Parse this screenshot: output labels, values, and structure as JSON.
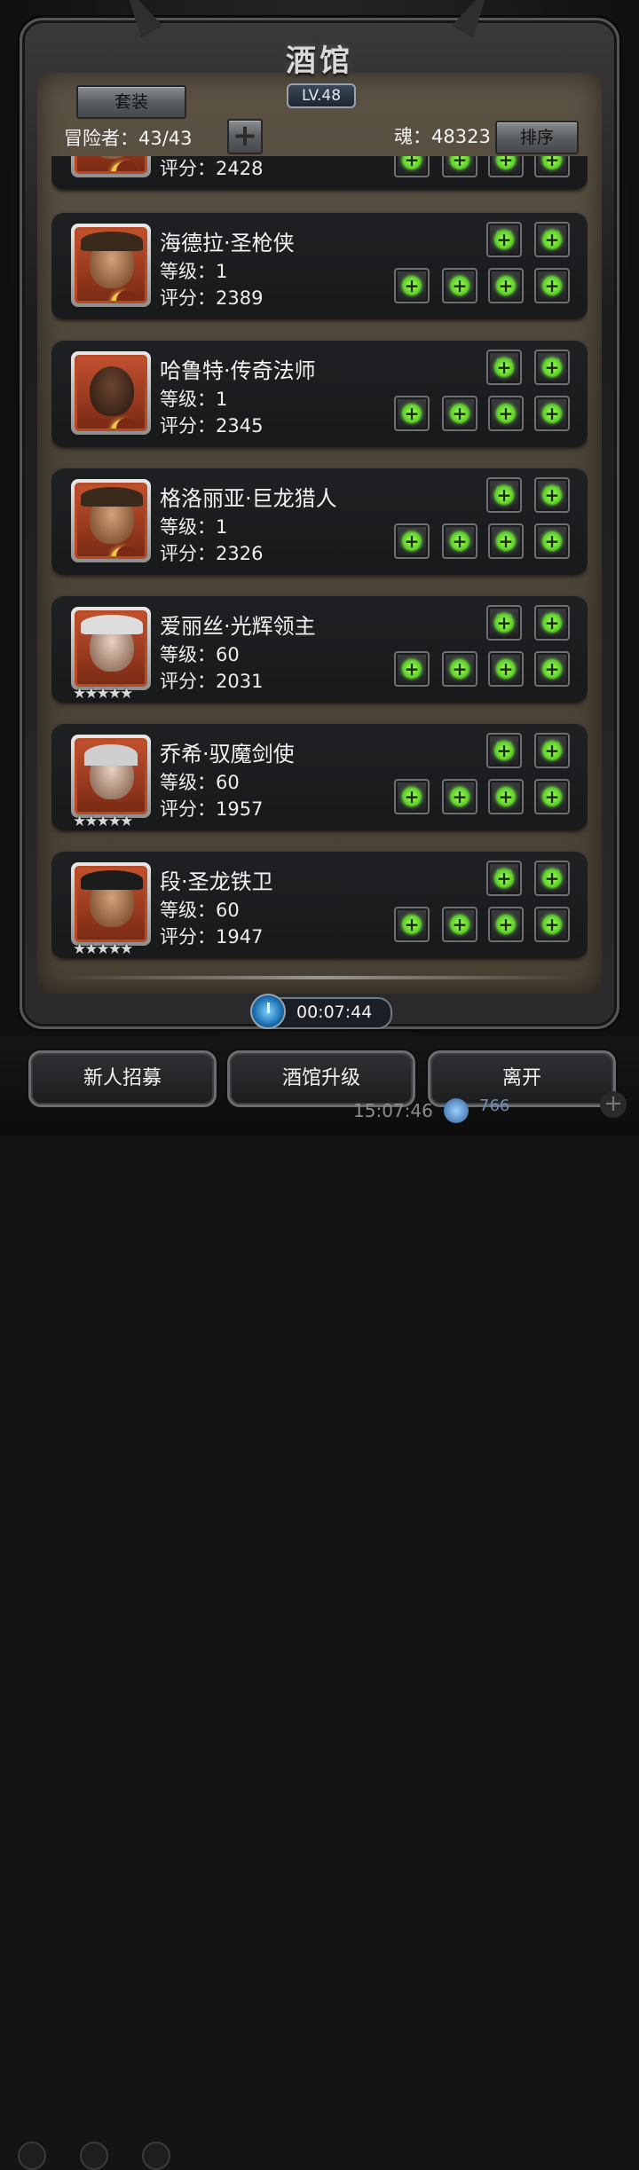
{
  "header": {
    "title": "酒馆",
    "level": "LV.48",
    "set_button": "套装",
    "adventurers": "冒险者：43/43",
    "souls": "魂：48323",
    "sort_button": "排序"
  },
  "heroes": [
    {
      "name": "",
      "level": "",
      "score": "评分：2428",
      "stars": false
    },
    {
      "name": "海德拉·圣枪侠",
      "level": "等级：1",
      "score": "评分：2389",
      "stars": false
    },
    {
      "name": "哈鲁特·传奇法师",
      "level": "等级：1",
      "score": "评分：2345",
      "stars": false
    },
    {
      "name": "格洛丽亚·巨龙猎人",
      "level": "等级：1",
      "score": "评分：2326",
      "stars": false
    },
    {
      "name": "爱丽丝·光辉领主",
      "level": "等级：60",
      "score": "评分：2031",
      "stars": true
    },
    {
      "name": "乔希·驭魔剑使",
      "level": "等级：60",
      "score": "评分：1957",
      "stars": true
    },
    {
      "name": "段·圣龙铁卫",
      "level": "等级：60",
      "score": "评分：1947",
      "stars": true
    }
  ],
  "star_glyphs": "★★★★★",
  "timer": "00:07:44",
  "buttons": {
    "recruit": "新人招募",
    "upgrade": "酒馆升级",
    "leave": "离开"
  },
  "system_clock": "15:07:46",
  "gem_count": "766",
  "colors": {
    "accent_green": "#5fd22c",
    "panel_brown": "#4b4437",
    "card_dark": "#1f2023"
  }
}
